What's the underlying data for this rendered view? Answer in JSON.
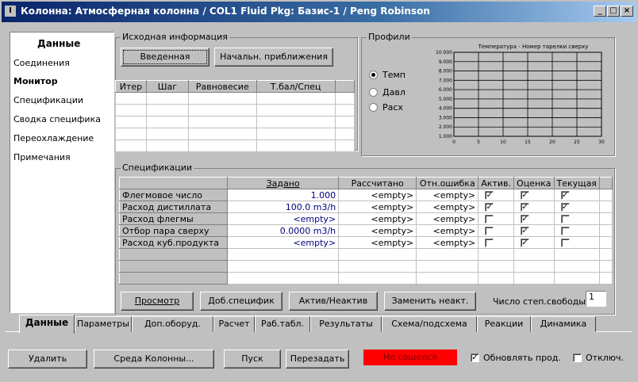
{
  "window": {
    "title": "Колонна: Атмосферная колонна / COL1  Fluid Pkg: Базис-1 / Peng Robinson",
    "minimize": "_",
    "maximize": "□",
    "close": "×"
  },
  "sidebar": {
    "title": "Данные",
    "items": [
      {
        "label": "Соединения",
        "bold": false
      },
      {
        "label": "Монитор",
        "bold": true
      },
      {
        "label": "Спецификации",
        "bold": false
      },
      {
        "label": "Сводка специфика",
        "bold": false
      },
      {
        "label": "Переохлаждение",
        "bold": false
      },
      {
        "label": "Примечания",
        "bold": false
      }
    ]
  },
  "source_info": {
    "group_label": "Исходная информация",
    "btn_entered": "Введенная",
    "btn_initial": "Начальн. приближения",
    "columns": [
      "Итер",
      "Шаг",
      "Равновесие",
      "Т.бал/Спец"
    ]
  },
  "profiles": {
    "group_label": "Профили",
    "radio": [
      {
        "label": "Темп",
        "checked": true
      },
      {
        "label": "Давл",
        "checked": false
      },
      {
        "label": "Расх",
        "checked": false
      }
    ],
    "chart_data": {
      "type": "line",
      "title": "Температура - Номер тарелки сверху",
      "x_ticks": [
        "0",
        "5",
        "10",
        "15",
        "20",
        "25",
        "30"
      ],
      "y_ticks": [
        "10.000",
        "9.000",
        "8.000",
        "7.000",
        "6.000",
        "5.000",
        "4.000",
        "3.000",
        "2.000",
        "1.000"
      ],
      "xlim": [
        0,
        30
      ],
      "ylim": [
        1,
        10
      ],
      "series": [],
      "grid": true
    }
  },
  "specs": {
    "group_label": "Спецификации",
    "columns": [
      "",
      "Задано",
      "Рассчитано",
      "Отн.ошибка",
      "Актив.",
      "Оценка",
      "Текущая"
    ],
    "rows": [
      {
        "name": "Флегмовое число",
        "spec": "1.000",
        "calc": "<empty>",
        "err": "<empty>",
        "active": true,
        "estimate": true,
        "current": true
      },
      {
        "name": "Расход дистиллата",
        "spec": "100.0 m3/h",
        "calc": "<empty>",
        "err": "<empty>",
        "active": true,
        "estimate": true,
        "current": true
      },
      {
        "name": "Расход флегмы",
        "spec": "<empty>",
        "calc": "<empty>",
        "err": "<empty>",
        "active": false,
        "estimate": true,
        "current": false
      },
      {
        "name": "Отбор пара сверху",
        "spec": "0.0000 m3/h",
        "calc": "<empty>",
        "err": "<empty>",
        "active": false,
        "estimate": true,
        "current": false
      },
      {
        "name": "Расход куб.продукта",
        "spec": "<empty>",
        "calc": "<empty>",
        "err": "<empty>",
        "active": false,
        "estimate": true,
        "current": false
      }
    ],
    "btn_view": "Просмотр",
    "btn_add": "Доб.специфик",
    "btn_toggle": "Актив/Неактив",
    "btn_replace": "Заменить неакт.",
    "dof_label": "Число степ.свободы",
    "dof_value": "1"
  },
  "tabs": [
    {
      "label": "Данные",
      "active": true
    },
    {
      "label": "Параметры",
      "active": false
    },
    {
      "label": "Доп.оборуд.",
      "active": false
    },
    {
      "label": "Расчет",
      "active": false
    },
    {
      "label": "Раб.табл.",
      "active": false
    },
    {
      "label": "Результаты",
      "active": false
    },
    {
      "label": "Схема/подсхема",
      "active": false
    },
    {
      "label": "Реакции",
      "active": false
    },
    {
      "label": "Динамика",
      "active": false
    }
  ],
  "bottom": {
    "btn_delete": "Удалить",
    "btn_env": "Среда Колонны...",
    "btn_run": "Пуск",
    "btn_reset": "Перезадать",
    "status": "Не сошелся",
    "status_color": "#ff0000",
    "update_label": "Обновлять прод.",
    "update_checked": true,
    "disable_label": "Отключ.",
    "disable_checked": false
  }
}
